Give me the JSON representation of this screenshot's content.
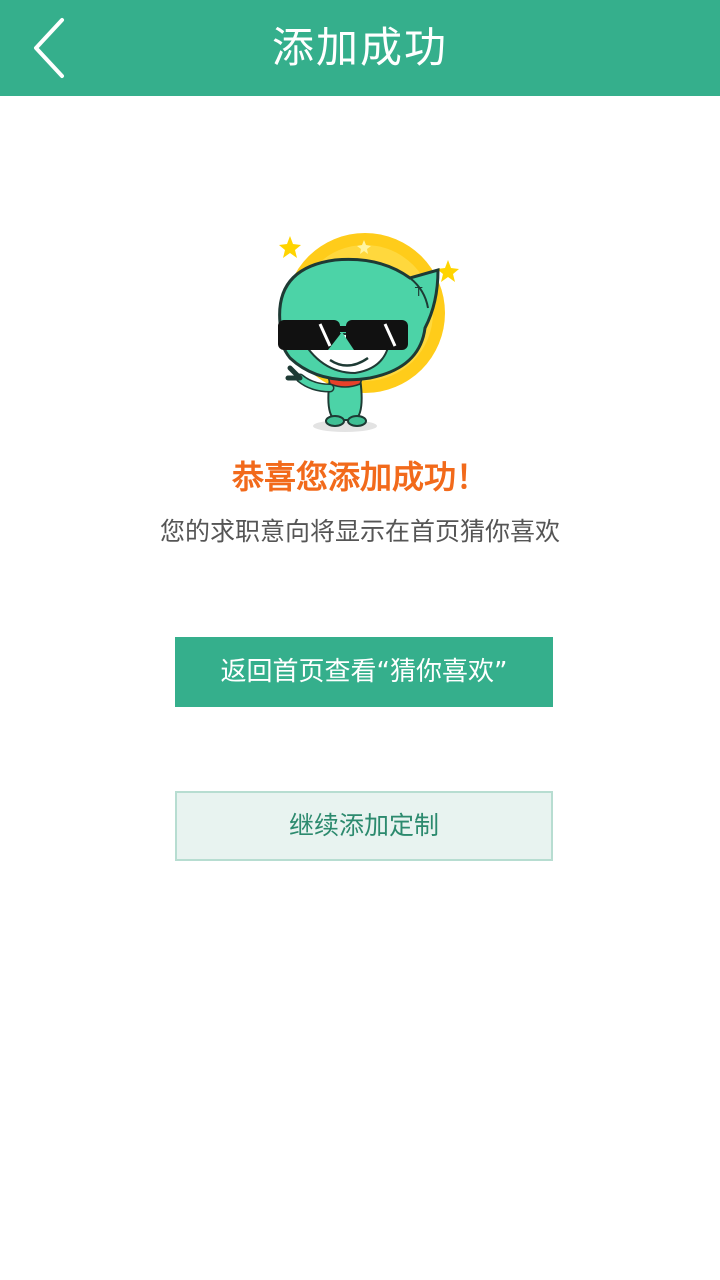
{
  "header": {
    "title": "添加成功",
    "back_icon": "chevron-left-icon"
  },
  "main": {
    "mascot_icon": "mascot-illustration",
    "success_title": "恭喜您添加成功！",
    "success_subtitle": "您的求职意向将显示在首页猜你喜欢",
    "primary_button_label": "返回首页查看“猜你喜欢”",
    "secondary_button_label": "继续添加定制"
  },
  "colors": {
    "header_bg": "#35af8c",
    "accent_orange": "#f26a1b",
    "secondary_bg": "#e8f3f0"
  }
}
